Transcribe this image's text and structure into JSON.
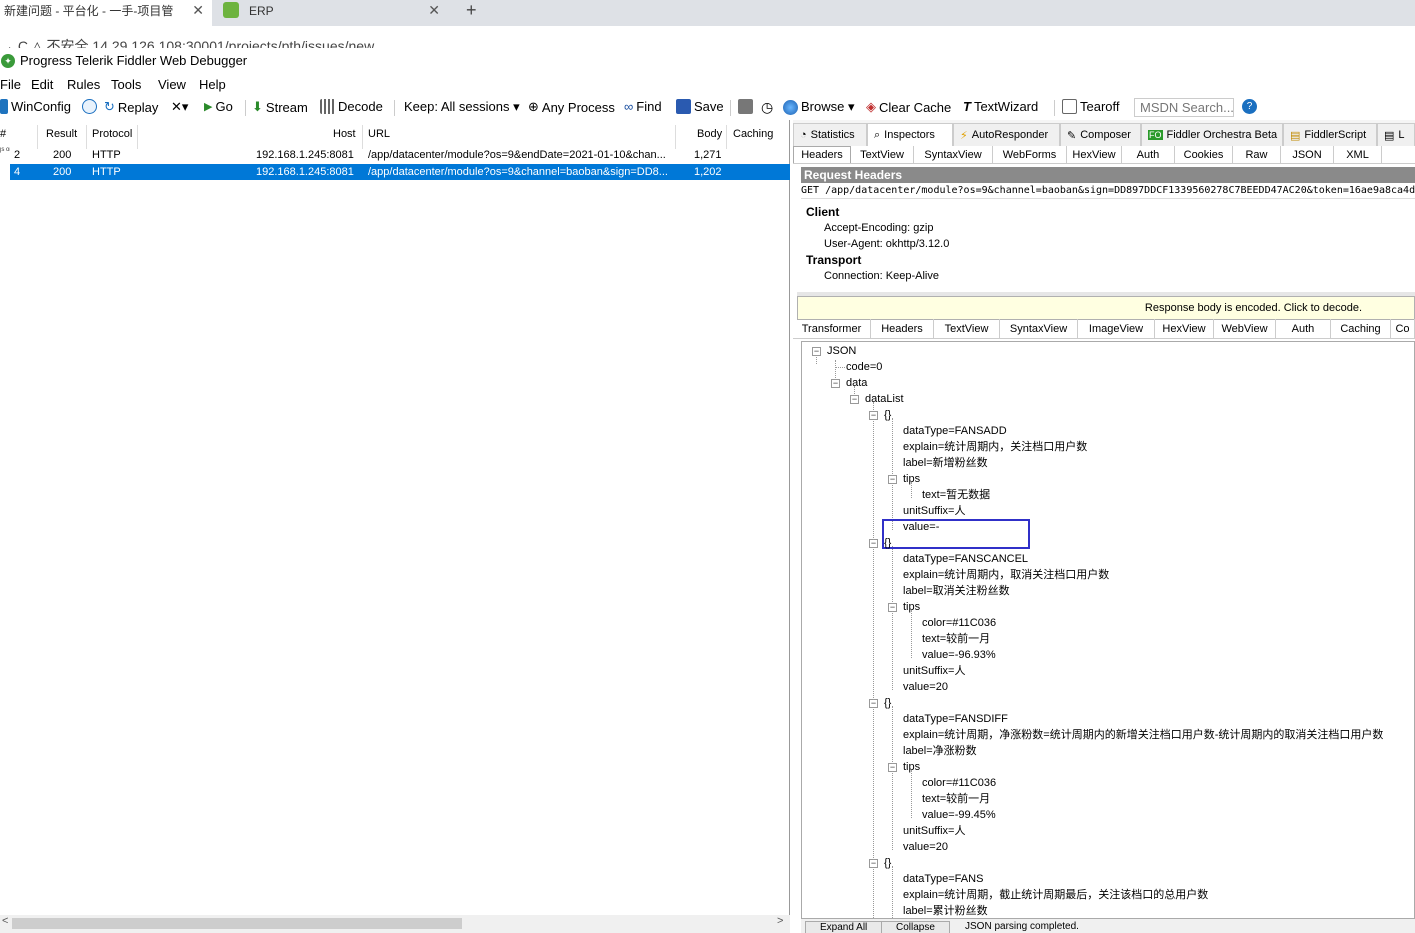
{
  "browser": {
    "tabs": [
      {
        "label": "新建问题 - 平台化 - 一手-项目管",
        "close": "✕"
      },
      {
        "label": "ERP",
        "close": "✕"
      }
    ],
    "new_tab": "+",
    "address_text": "→  C  △ 不安全  14.29.126.108:30001/projects/pth/issues/new"
  },
  "app": {
    "title": "Progress Telerik Fiddler Web Debugger"
  },
  "menu": [
    "File",
    "Edit",
    "Rules",
    "Tools",
    "View",
    "Help"
  ],
  "toolbar": {
    "winconfig": "WinConfig",
    "replay": "Replay",
    "remove": "✕▾",
    "go": "Go",
    "stream": "Stream",
    "decode": "Decode",
    "keep": "Keep: All sessions ▾",
    "any_process": "Any Process",
    "find": "Find",
    "save": "Save",
    "browse": "Browse ▾",
    "clear_cache": "Clear Cache",
    "textwizard": "TextWizard",
    "tearoff": "Tearoff",
    "msdn": "MSDN Search...",
    "colors": {
      "stream": "#2a8a2a",
      "find": "#1a4fa0",
      "save": "#2a5ab0",
      "clear": "#c03030"
    }
  },
  "sessions": {
    "headers": {
      "num": "#",
      "result": "Result",
      "protocol": "Protocol",
      "host": "Host",
      "url": "URL",
      "body": "Body",
      "caching": "Caching"
    },
    "rows": [
      {
        "num": "2",
        "result": "200",
        "protocol": "HTTP",
        "host": "192.168.1.245:8081",
        "url": "/app/datacenter/module?os=9&endDate=2021-01-10&chan...",
        "body": "1,271",
        "icon": "js on"
      },
      {
        "num": "4",
        "result": "200",
        "protocol": "HTTP",
        "host": "192.168.1.245:8081",
        "url": "/app/datacenter/module?os=9&channel=baoban&sign=DD8...",
        "body": "1,202",
        "icon": "js on"
      }
    ],
    "scroll_left": "<",
    "scroll_right": ">"
  },
  "inspector_tabs": [
    "Statistics",
    "Inspectors",
    "AutoResponder",
    "Composer",
    "Fiddler Orchestra Beta",
    "FiddlerScript",
    "L"
  ],
  "inspector_active": "Inspectors",
  "request_tabs": [
    "Headers",
    "TextView",
    "SyntaxView",
    "WebForms",
    "HexView",
    "Auth",
    "Cookies",
    "Raw",
    "JSON",
    "XML"
  ],
  "request": {
    "bar_title": "Request Headers",
    "line": "GET /app/datacenter/module?os=9&channel=baoban&sign=DD897DDCF1339560278C7BEEDD47AC20&token=16ae9a8ca4d",
    "groups": [
      {
        "name": "Client",
        "items": [
          "Accept-Encoding: gzip",
          "User-Agent: okhttp/3.12.0"
        ]
      },
      {
        "name": "Transport",
        "items": [
          "Connection: Keep-Alive"
        ]
      }
    ]
  },
  "response": {
    "encoded_notice": "Response body is encoded. Click to decode.",
    "tabs": [
      "Transformer",
      "Headers",
      "TextView",
      "SyntaxView",
      "ImageView",
      "HexView",
      "WebView",
      "Auth",
      "Caching",
      "Co"
    ],
    "bottom_buttons": [
      "Expand All",
      "Collapse",
      "JSON parsing completed."
    ]
  },
  "json_tree": {
    "root": "JSON",
    "code": "code=0",
    "data": "data",
    "dataList": "dataList",
    "items": [
      {
        "open": "{}",
        "lines": [
          "dataType=FANSADD",
          "explain=统计周期内，关注档口用户数",
          "label=新增粉丝数"
        ],
        "tips": "tips",
        "tip_lines": [
          "text=暂无数据"
        ],
        "after": [
          "unitSuffix=人",
          "value=-"
        ]
      },
      {
        "open": "{}",
        "lines": [
          "dataType=FANSCANCEL",
          "explain=统计周期内，取消关注档口用户数",
          "label=取消关注粉丝数"
        ],
        "tips": "tips",
        "tip_lines": [
          "color=#11C036",
          "text=较前一月",
          "value=-96.93%"
        ],
        "after": [
          "unitSuffix=人",
          "value=20"
        ]
      },
      {
        "open": "{}",
        "lines": [
          "dataType=FANSDIFF",
          "explain=统计周期，净涨粉数=统计周期内的新增关注档口用户数-统计周期内的取消关注档口用户数",
          "label=净涨粉数"
        ],
        "tips": "tips",
        "tip_lines": [
          "color=#11C036",
          "text=较前一月",
          "value=-99.45%"
        ],
        "after": [
          "unitSuffix=人",
          "value=20"
        ]
      },
      {
        "open": "{}",
        "lines": [
          "dataType=FANS",
          "explain=统计周期，截止统计周期最后，关注该档口的总用户数",
          "label=累计粉丝数"
        ],
        "tips": "",
        "tip_lines": [],
        "after": []
      }
    ]
  }
}
